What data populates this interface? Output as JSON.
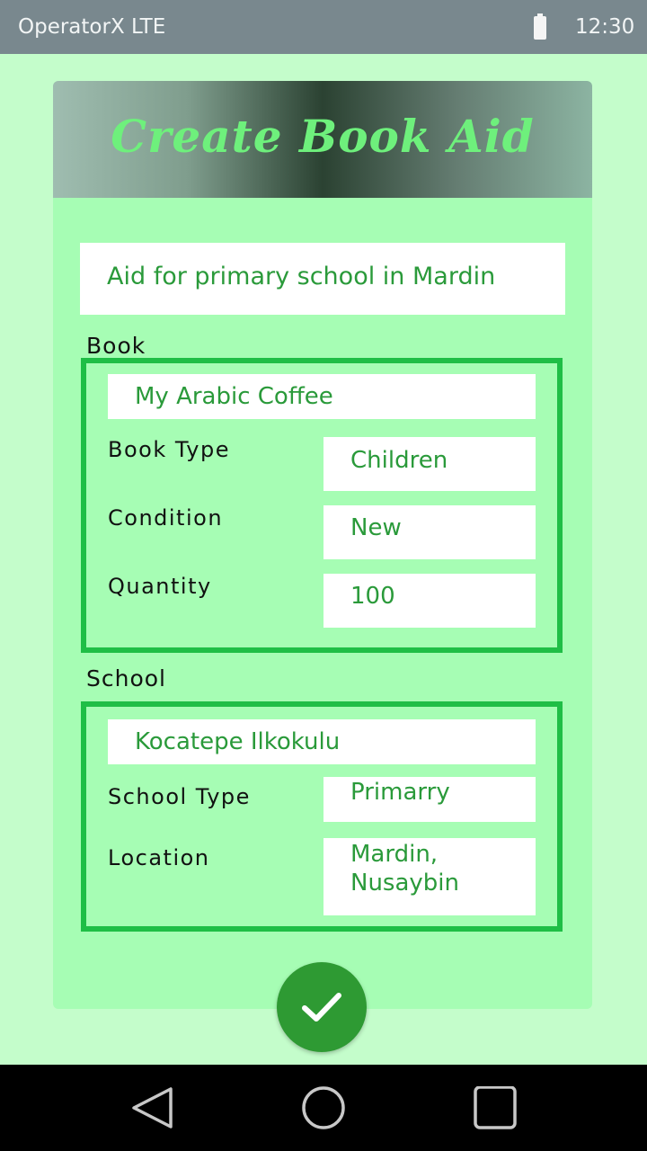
{
  "status_bar": {
    "carrier": "OperatorX LTE",
    "time": "12:30"
  },
  "header": {
    "title": "Create Book Aid"
  },
  "aid": {
    "name": "Aid for primary school in Mardin"
  },
  "book": {
    "section_label": "Book",
    "title": "My Arabic Coffee",
    "rows": [
      {
        "label": "Book Type",
        "value": "Children"
      },
      {
        "label": "Condition",
        "value": "New"
      },
      {
        "label": "Quantity",
        "value": "100"
      }
    ]
  },
  "school": {
    "section_label": "School",
    "name": "Kocatepe Ilkokulu",
    "rows": [
      {
        "label": "School Type",
        "value": "Primarry"
      },
      {
        "label": "Location",
        "value": "Mardin, Nusaybin"
      }
    ]
  },
  "submit": {
    "icon": "check-icon"
  },
  "navigation": {
    "back_icon": "back-triangle-icon",
    "home_icon": "home-circle-icon",
    "recents_icon": "recents-square-icon"
  },
  "colors": {
    "background": "#c4fdcb",
    "card": "#a6fdb4",
    "accent": "#1fbe46",
    "text_green": "#2a9a3a",
    "fab": "#2e9a33"
  }
}
